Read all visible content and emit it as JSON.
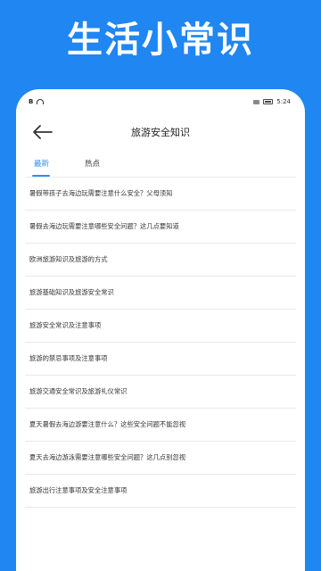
{
  "banner": {
    "title": "生活小常识"
  },
  "status_bar": {
    "left_icon": "sim-icon",
    "time": "5:24"
  },
  "header": {
    "title": "旅游安全知识",
    "back_icon": "arrow-left-icon"
  },
  "tabs": [
    {
      "label": "最新",
      "active": true
    },
    {
      "label": "热点",
      "active": false
    }
  ],
  "articles": [
    "暑假带孩子去海边玩需要注意什么安全？父母须知",
    "暑假去海边玩需要注意哪些安全问题？这几点要知道",
    "欧洲旅游知识及旅游的方式",
    "旅游基础知识及旅游安全常识",
    "旅游安全常识及注意事项",
    "旅游的禁忌事项及注意事项",
    "旅游交通安全常识及旅游礼仪常识",
    "夏天暑假去海边游要注意什么？这些安全问题不能忽视",
    "夏天去海边游泳需要注意哪些安全问题？这几点别忽视",
    "旅游出行注意事项及安全注意事项"
  ],
  "colors": {
    "brand_blue": "#1f86f2",
    "tab_active": "#2f8df5"
  }
}
